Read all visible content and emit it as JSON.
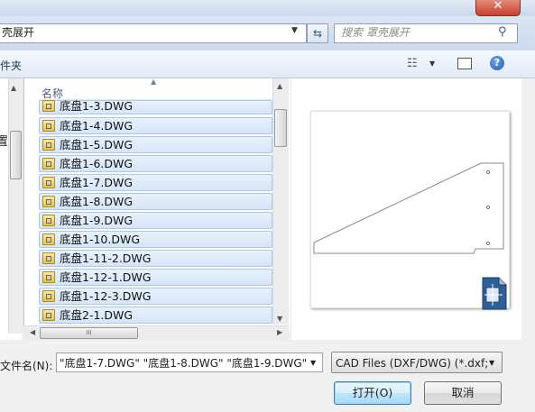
{
  "window": {
    "close_label": "✕"
  },
  "address": {
    "path": "壳展开"
  },
  "search": {
    "placeholder": "搜索 罩壳展开"
  },
  "toolbar": {
    "left_text": "件夹"
  },
  "nav": {
    "partial_text": "置"
  },
  "file_list": {
    "column_header": "名称",
    "files": [
      {
        "name": "底盘1-3.DWG"
      },
      {
        "name": "底盘1-4.DWG"
      },
      {
        "name": "底盘1-5.DWG"
      },
      {
        "name": "底盘1-6.DWG"
      },
      {
        "name": "底盘1-7.DWG"
      },
      {
        "name": "底盘1-8.DWG"
      },
      {
        "name": "底盘1-9.DWG"
      },
      {
        "name": "底盘1-10.DWG"
      },
      {
        "name": "底盘1-11-2.DWG"
      },
      {
        "name": "底盘1-12-1.DWG"
      },
      {
        "name": "底盘1-12-3.DWG"
      },
      {
        "name": "底盘2-1.DWG"
      }
    ]
  },
  "filename": {
    "label": "文件名(N):",
    "value": "\"底盘1-7.DWG\" \"底盘1-8.DWG\" \"底盘1-9.DWG\""
  },
  "filetype": {
    "selected": "CAD Files (DXF/DWG) (*.dxf;"
  },
  "buttons": {
    "open": "打开(O)",
    "cancel": "取消"
  },
  "scroll": {
    "h_thumb_grip": "III"
  }
}
